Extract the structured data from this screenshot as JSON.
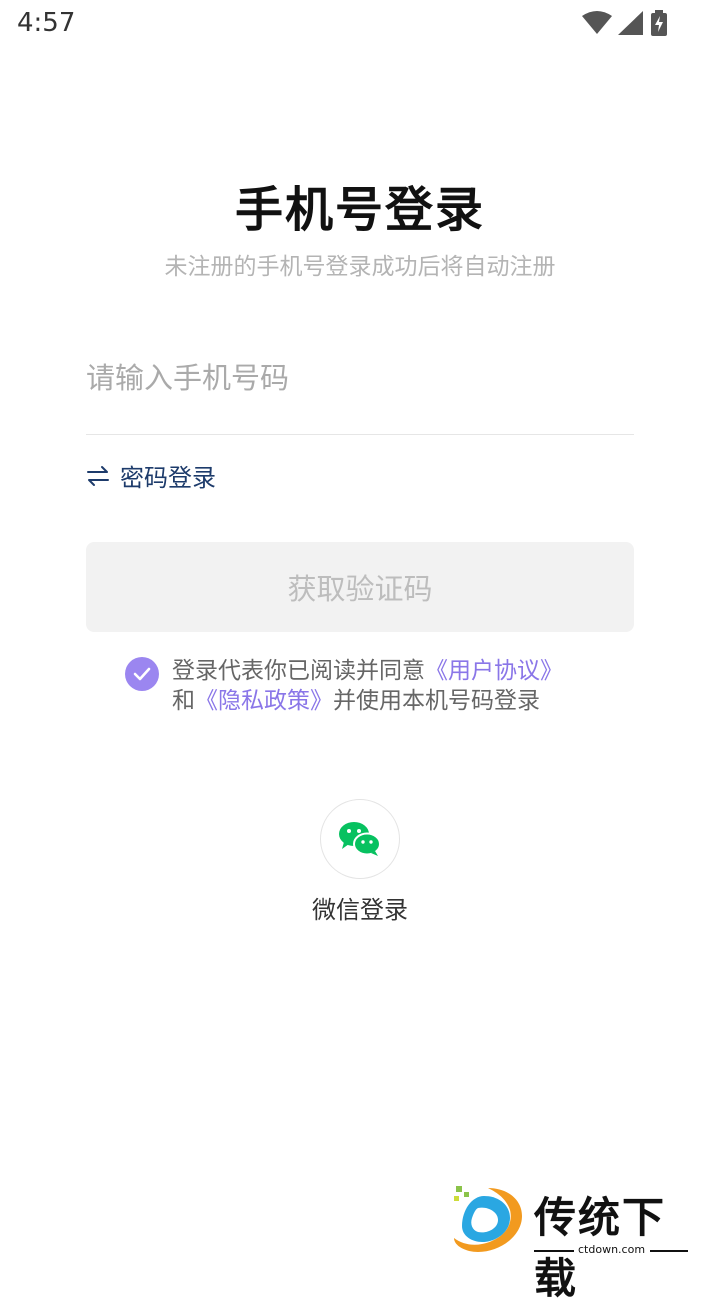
{
  "status_bar": {
    "time": "4:57"
  },
  "title": "手机号登录",
  "subtitle": "未注册的手机号登录成功后将自动注册",
  "phone_input": {
    "placeholder": "请输入手机号码",
    "value": ""
  },
  "password_login": {
    "label": "密码登录",
    "icon": "swap-arrows-icon"
  },
  "get_code_button": {
    "label": "获取验证码"
  },
  "agreement": {
    "checked": true,
    "prefix": "登录代表你已阅读并同意",
    "user_agreement": "《用户协议》",
    "and": "和",
    "privacy_policy": "《隐私政策》",
    "suffix": "并使用本机号码登录"
  },
  "wechat_login": {
    "label": "微信登录",
    "icon": "wechat-icon"
  },
  "watermark": {
    "name": "传统下载",
    "url": "ctdown.com"
  },
  "colors": {
    "accent": "#9b86f0",
    "link": "#8a76e8",
    "wechat": "#07c160",
    "password_link": "#1d3b6b"
  }
}
